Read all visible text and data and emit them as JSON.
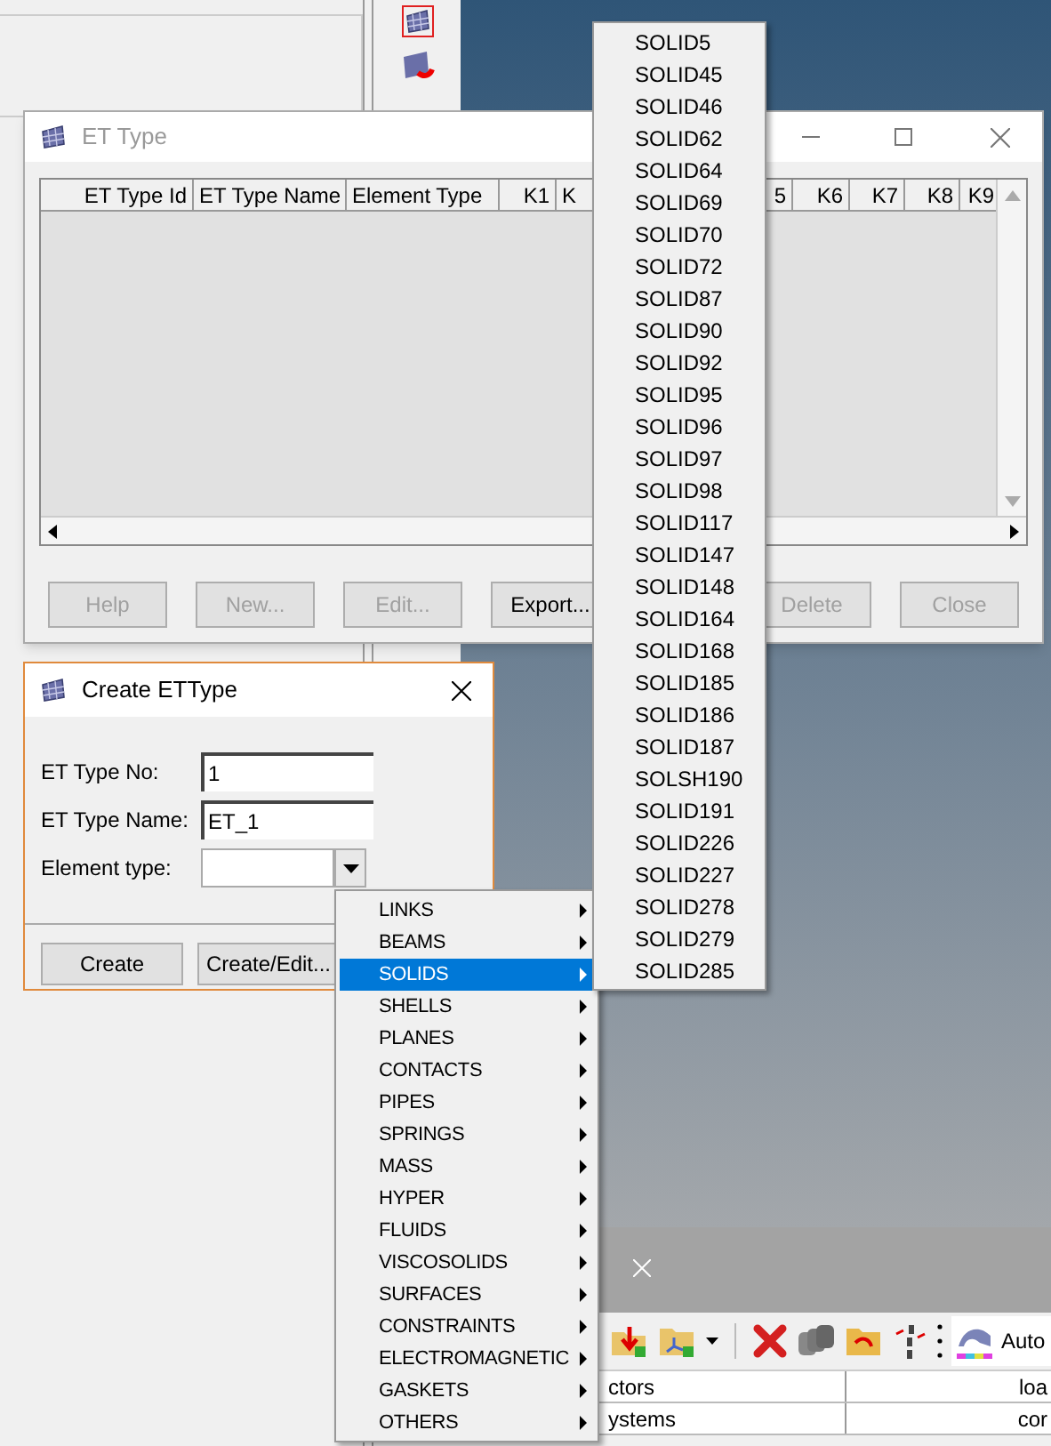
{
  "et_type_window": {
    "title": "ET Type",
    "active": false,
    "columns": [
      "ET Type Id",
      "ET Type Name",
      "Element Type",
      "K1",
      "K",
      "5",
      "K6",
      "K7",
      "K8",
      "K9"
    ],
    "buttons": [
      {
        "label": "Help",
        "disabled": true
      },
      {
        "label": "New...",
        "disabled": true
      },
      {
        "label": "Edit...",
        "disabled": true
      },
      {
        "label": "Export...",
        "disabled": false
      },
      {
        "label": "Delete",
        "disabled": true
      },
      {
        "label": "Close",
        "disabled": true
      }
    ]
  },
  "create_dialog": {
    "title": "Create ETType",
    "fields": [
      {
        "kind": "text",
        "label": "ET Type No:",
        "value": "1"
      },
      {
        "kind": "text",
        "label": "ET Type Name:",
        "value": "ET_1"
      },
      {
        "kind": "combo",
        "label": "Element type:"
      }
    ],
    "buttons": [
      "Create",
      "Create/Edit..."
    ]
  },
  "element_menu": {
    "items": [
      {
        "label": "LINKS",
        "selected": false
      },
      {
        "label": "BEAMS",
        "selected": false
      },
      {
        "label": "SOLIDS",
        "selected": true
      },
      {
        "label": "SHELLS",
        "selected": false
      },
      {
        "label": "PLANES",
        "selected": false
      },
      {
        "label": "CONTACTS",
        "selected": false
      },
      {
        "label": "PIPES",
        "selected": false
      },
      {
        "label": "SPRINGS",
        "selected": false
      },
      {
        "label": "MASS",
        "selected": false
      },
      {
        "label": "HYPER",
        "selected": false
      },
      {
        "label": "FLUIDS",
        "selected": false
      },
      {
        "label": "VISCOSOLIDS",
        "selected": false
      },
      {
        "label": "SURFACES",
        "selected": false
      },
      {
        "label": "CONSTRAINTS",
        "selected": false
      },
      {
        "label": "ELECTROMAGNETIC",
        "selected": false
      },
      {
        "label": "GASKETS",
        "selected": false
      },
      {
        "label": "OTHERS",
        "selected": false
      }
    ]
  },
  "solids_submenu": {
    "items": [
      "SOLID5",
      "SOLID45",
      "SOLID46",
      "SOLID62",
      "SOLID64",
      "SOLID69",
      "SOLID70",
      "SOLID72",
      "SOLID87",
      "SOLID90",
      "SOLID92",
      "SOLID95",
      "SOLID96",
      "SOLID97",
      "SOLID98",
      "SOLID117",
      "SOLID147",
      "SOLID148",
      "SOLID164",
      "SOLID168",
      "SOLID185",
      "SOLID186",
      "SOLID187",
      "SOLSH190",
      "SOLID191",
      "SOLID226",
      "SOLID227",
      "SOLID278",
      "SOLID279",
      "SOLID285"
    ]
  },
  "bottom_toolbar": {
    "preset": "Auto"
  },
  "bottom_table": {
    "rows": [
      [
        "ctors",
        "loa"
      ],
      [
        "ystems",
        "cor"
      ]
    ]
  }
}
